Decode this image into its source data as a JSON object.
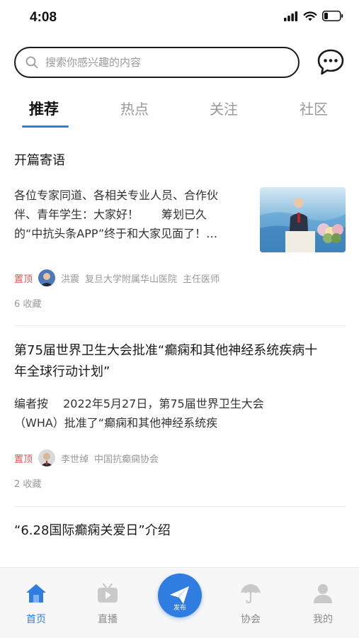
{
  "status_bar": {
    "time": "4:08"
  },
  "search": {
    "placeholder": "搜索你感兴趣的内容"
  },
  "tabs": [
    {
      "label": "推荐",
      "active": true
    },
    {
      "label": "热点",
      "active": false
    },
    {
      "label": "关注",
      "active": false
    },
    {
      "label": "社区",
      "active": false
    }
  ],
  "articles": [
    {
      "title": "开篇寄语",
      "body_lines": [
        "各位专家同道、各相关专业人员、合作伙",
        "伴、青年学生：大家好！　　筹划已久",
        "的“中抗头条APP”终于和大家见面了！…"
      ],
      "pin": "置顶",
      "author": "洪震",
      "org": "复旦大学附属华山医院",
      "role": "主任医师",
      "favorites": "6 收藏"
    },
    {
      "title_lines": [
        "第75届世界卫生大会批准“癫痫和其他神经系统疾病十",
        "年全球行动计划”"
      ],
      "body_lines": [
        "编者按　 2022年5月27日，第75届世界卫生大会",
        "（WHA）批准了“癫痫和其他神经系统疾"
      ],
      "pin": "置顶",
      "author": "李世绰",
      "org": "中国抗癫痫协会",
      "favorites": "2 收藏"
    },
    {
      "title": "“6.28国际癫痫关爱日”介绍"
    }
  ],
  "bottom_nav": {
    "home": "首页",
    "live": "直播",
    "publish": "发布",
    "association": "协会",
    "mine": "我的"
  },
  "colors": {
    "accent": "#2f7de1",
    "pin": "#d9534f"
  }
}
